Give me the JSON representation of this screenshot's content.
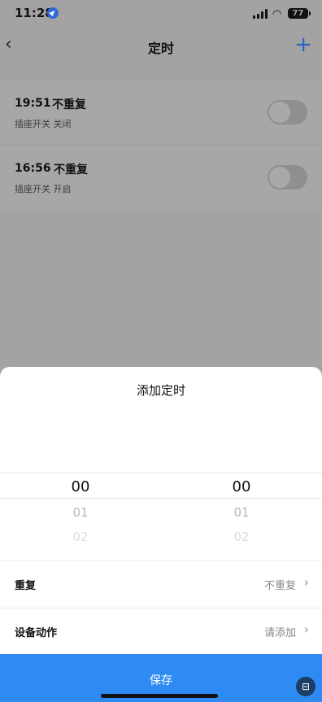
{
  "status_bar": {
    "time": "11:28",
    "battery": "77"
  },
  "nav": {
    "title": "定时",
    "back_icon": "chevron-left-icon",
    "add_icon": "plus-icon"
  },
  "timers": [
    {
      "time": "19:51",
      "repeat": "不重复",
      "desc": "插座开关 关闭",
      "enabled": false
    },
    {
      "time": "16:56",
      "repeat": "不重复",
      "desc": "插座开关 开启",
      "enabled": false
    }
  ],
  "sheet": {
    "title": "添加定时",
    "picker": {
      "hours": {
        "selected": "00",
        "next": "01",
        "next2": "02"
      },
      "minutes": {
        "selected": "00",
        "next": "01",
        "next2": "02"
      }
    },
    "repeat": {
      "label": "重复",
      "value": "不重复"
    },
    "action": {
      "label": "设备动作",
      "value": "请添加"
    },
    "save_label": "保存"
  },
  "colors": {
    "accent": "#2d8bf3",
    "nav_plus": "#2b62c4",
    "overlay": "#a3a3a3"
  }
}
